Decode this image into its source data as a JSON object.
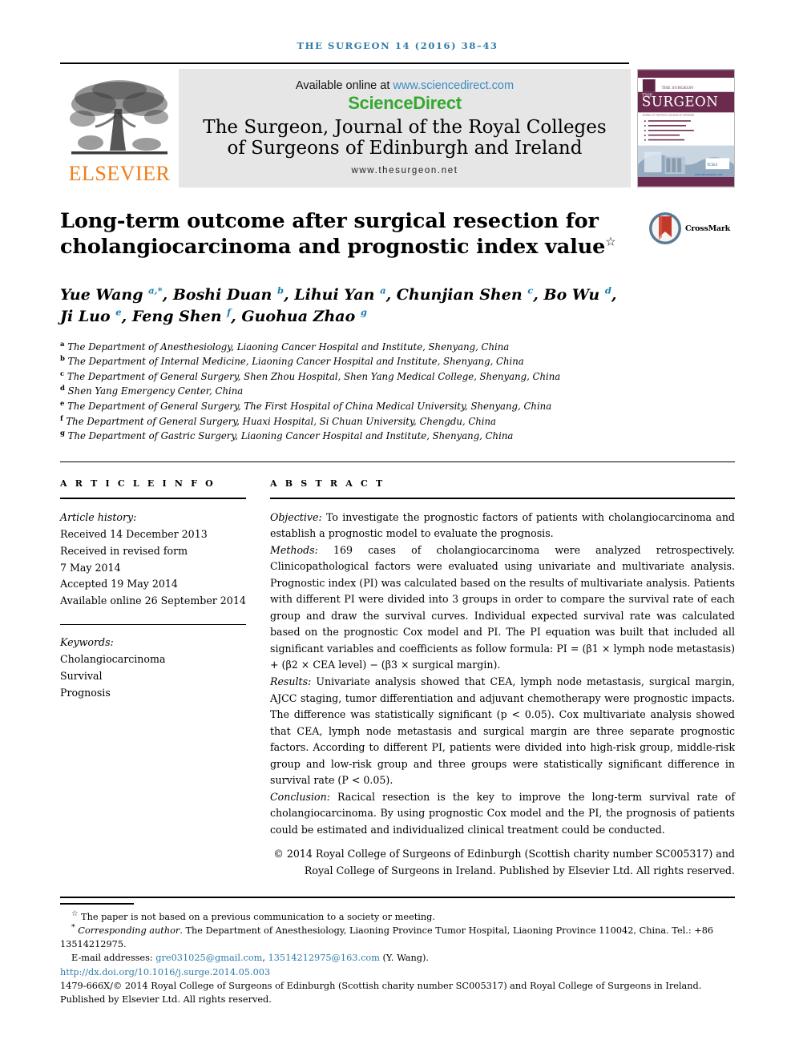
{
  "running_head": "THE SURGEON 14 (2016) 38–43",
  "masthead": {
    "publisher_name": "ELSEVIER",
    "available_text": "Available online at ",
    "sciencedirect_url": "www.sciencedirect.com",
    "sciencedirect_logo": "ScienceDirect",
    "journal_title_line1": "The Surgeon, Journal of the Royal Colleges",
    "journal_title_line2": "of Surgeons of Edinburgh and Ireland",
    "journal_url": "www.thesurgeon.net",
    "cover_title_the": "THE",
    "cover_title_main": "SURGEON",
    "cover_subtitle": "JOURNAL OF THE ROYAL COLLEGES OF SURGEONS OF EDINBURGH AND IRELAND",
    "cover_url": "www.thesurgeon.net"
  },
  "colors": {
    "link_blue": "#2e7ca8",
    "sciencedirect_green": "#36a832",
    "sciencedirect_blue": "#3b8bc4",
    "elsevier_orange": "#ef7d1a",
    "cover_purple": "#6b2b4e",
    "crossmark_red": "#c0392b"
  },
  "title": {
    "line1": "Long-term outcome after surgical resection for",
    "line2": "cholangiocarcinoma and prognostic index value",
    "marker": "☆"
  },
  "crossmark": {
    "label": "CrossMark"
  },
  "authors": {
    "line1": "Yue Wang <sup>a,*</sup>, Boshi Duan <sup>b</sup>, Lihui Yan <sup>a</sup>, Chunjian Shen <sup>c</sup>, Bo Wu <sup>d</sup>,",
    "line2": "Ji Luo <sup>e</sup>, Feng Shen <sup>f</sup>, Guohua Zhao <sup>g</sup>"
  },
  "affiliations": [
    {
      "marker": "a",
      "text": "The Department of Anesthesiology, Liaoning Cancer Hospital and Institute, Shenyang, China"
    },
    {
      "marker": "b",
      "text": "The Department of Internal Medicine, Liaoning Cancer Hospital and Institute, Shenyang, China"
    },
    {
      "marker": "c",
      "text": "The Department of General Surgery, Shen Zhou Hospital, Shen Yang Medical College, Shenyang, China"
    },
    {
      "marker": "d",
      "text": "Shen Yang Emergency Center, China"
    },
    {
      "marker": "e",
      "text": "The Department of General Surgery, The First Hospital of China Medical University, Shenyang, China"
    },
    {
      "marker": "f",
      "text": "The Department of General Surgery, Huaxi Hospital, Si Chuan University, Chengdu, China"
    },
    {
      "marker": "g",
      "text": "The Department of Gastric Surgery, Liaoning Cancer Hospital and Institute, Shenyang, China"
    }
  ],
  "article_info": {
    "heading": "A R T I C L E  I N F O",
    "history_label": "Article history:",
    "history": [
      "Received 14 December 2013",
      "Received in revised form",
      "7 May 2014",
      "Accepted 19 May 2014",
      "Available online 26 September 2014"
    ],
    "keywords_label": "Keywords:",
    "keywords": [
      "Cholangiocarcinoma",
      "Survival",
      "Prognosis"
    ]
  },
  "abstract": {
    "heading": "A B S T R A C T",
    "sections": [
      {
        "label": "Objective:",
        "text": " To investigate the prognostic factors of patients with cholangiocarcinoma and establish a prognostic model to evaluate the prognosis."
      },
      {
        "label": "Methods:",
        "text": " 169 cases of cholangiocarcinoma were analyzed retrospectively. Clinicopathological factors were evaluated using univariate and multivariate analysis. Prognostic index (PI) was calculated based on the results of multivariate analysis. Patients with different PI were divided into 3 groups in order to compare the survival rate of each group and draw the survival curves. Individual expected survival rate was calculated based on the prognostic Cox model and PI. The PI equation was built that included all significant variables and coefficients as follow formula: PI = (β1 × lymph node metastasis) + (β2 × CEA level) − (β3 × surgical margin)."
      },
      {
        "label": "Results:",
        "text": " Univariate analysis showed that CEA, lymph node metastasis, surgical margin, AJCC staging, tumor differentiation and adjuvant chemotherapy were prognostic impacts. The difference was statistically significant (p < 0.05). Cox multivariate analysis showed that CEA, lymph node metastasis and surgical margin are three separate prognostic factors. According to different PI, patients were divided into high-risk group, middle-risk group and low-risk group and three groups were statistically significant difference in survival rate (P < 0.05)."
      },
      {
        "label": "Conclusion:",
        "text": " Racical resection is the key to improve the long-term survival rate of cholangiocarcinoma. By using prognostic Cox model and the PI, the prognosis of patients could be estimated and individualized clinical treatment could be conducted."
      }
    ],
    "copyright": "© 2014 Royal College of Surgeons of Edinburgh (Scottish charity number SC005317) and Royal College of Surgeons in Ireland. Published by Elsevier Ltd. All rights reserved."
  },
  "footnotes": {
    "star_note": "The paper is not based on a previous communication to a society or meeting.",
    "star_marker": "☆",
    "corresponding_marker": "*",
    "corresponding_label": "Corresponding author",
    "corresponding_text": ". The Department of Anesthesiology, Liaoning Province Tumor Hospital, Liaoning Province 110042, China. Tel.: +86 13514212975.",
    "email_label": "E-mail addresses: ",
    "email1": "gre031025@gmail.com",
    "email_sep": ", ",
    "email2": "13514212975@163.com",
    "email_attrib": " (Y. Wang).",
    "doi": "http://dx.doi.org/10.1016/j.surge.2014.05.003",
    "issn_line": "1479-666X/© 2014 Royal College of Surgeons of Edinburgh (Scottish charity number SC005317) and Royal College of Surgeons in Ireland. Published by Elsevier Ltd. All rights reserved."
  }
}
